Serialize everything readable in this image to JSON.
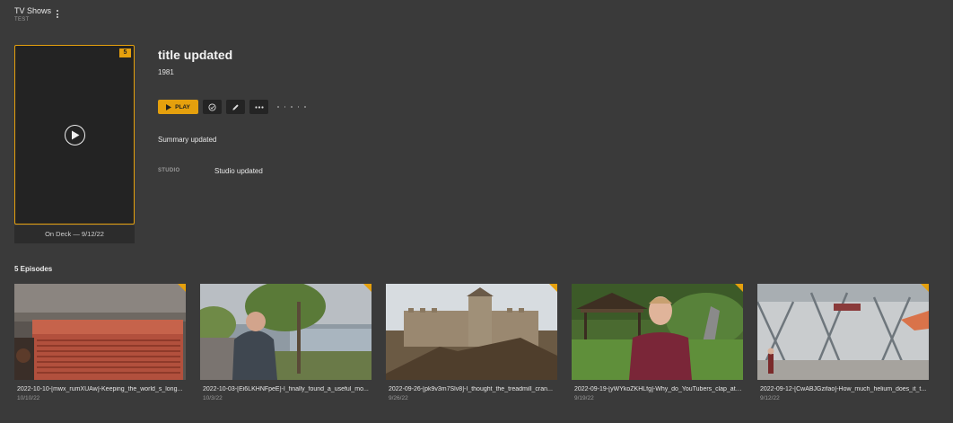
{
  "breadcrumb": {
    "title": "TV Shows",
    "subtitle": "TEST"
  },
  "show": {
    "title": "title updated",
    "year": "1981",
    "summary": "Summary updated",
    "studio_label": "STUDIO",
    "studio_value": "Studio updated",
    "unwatched_count": "5",
    "on_deck": "On Deck — 9/12/22"
  },
  "actions": {
    "play_label": "PLAY",
    "icons": [
      "play-icon",
      "check-circle-icon",
      "edit-pencil-icon",
      "more-icon"
    ]
  },
  "episodes": {
    "heading": "5 Episodes",
    "items": [
      {
        "title": "2022-10-10-[mwx_rumXUAw]-Keeping_the_world_s_long...",
        "date": "10/10/22"
      },
      {
        "title": "2022-10-03-[Ei6LKHNFpeE]-I_finally_found_a_useful_mo...",
        "date": "10/3/22"
      },
      {
        "title": "2022-09-26-[pk9v3m7Slv8]-I_thought_the_treadmill_cran...",
        "date": "9/26/22"
      },
      {
        "title": "2022-09-19-[yWYkoZKHLfg]-Why_do_YouTubers_clap_at_...",
        "date": "9/19/22"
      },
      {
        "title": "2022-09-12-[CwABJGzifao]-How_much_helium_does_it_t...",
        "date": "9/12/22"
      }
    ]
  },
  "colors": {
    "accent": "#e5a00d",
    "background": "#3a3a3a",
    "panel": "#242424"
  }
}
